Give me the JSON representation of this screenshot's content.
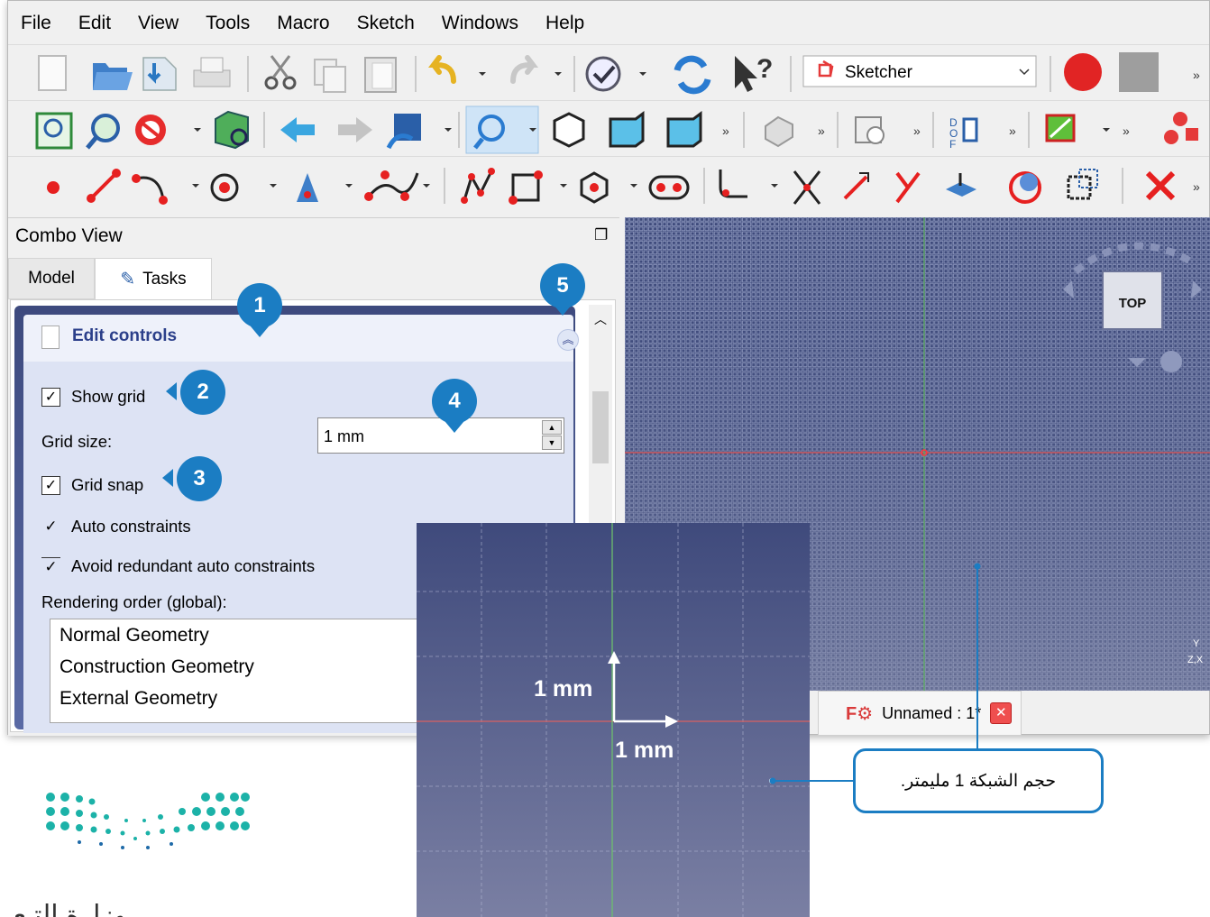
{
  "menu": [
    "File",
    "Edit",
    "View",
    "Tools",
    "Macro",
    "Sketch",
    "Windows",
    "Help"
  ],
  "workbench": {
    "selected": "Sketcher"
  },
  "combo": {
    "title": "Combo View",
    "tabs": [
      "Model",
      "Tasks"
    ],
    "active_tab": "Tasks"
  },
  "edit_controls": {
    "title": "Edit controls",
    "show_grid": {
      "label": "Show grid",
      "checked": true
    },
    "grid_size": {
      "label": "Grid size:",
      "value": "1 mm"
    },
    "grid_snap": {
      "label": "Grid snap",
      "checked": true
    },
    "auto_constraints": {
      "label": "Auto constraints",
      "checked": true
    },
    "avoid_redundant": {
      "label": "Avoid redundant auto constraints",
      "checked": true
    },
    "rendering_order_label": "Rendering order (global):",
    "rendering_order": [
      "Normal Geometry",
      "Construction Geometry",
      "External Geometry"
    ]
  },
  "viewport": {
    "navcube_face": "TOP",
    "axis_hint": "Y\nZ,X"
  },
  "document_tab": {
    "label": "Unnamed : 1*"
  },
  "zoom_inset": {
    "vertical_label": "1 mm",
    "horizontal_label": "1 mm"
  },
  "callouts": [
    "1",
    "2",
    "3",
    "4",
    "5"
  ],
  "note": "حجم الشبكة 1 مليمتر.",
  "logo_text": "وزارة التـعـ",
  "colors": {
    "accent": "#1b7dc3",
    "viewport": "#3f4b7c",
    "task_header": "#2b3f8a"
  }
}
